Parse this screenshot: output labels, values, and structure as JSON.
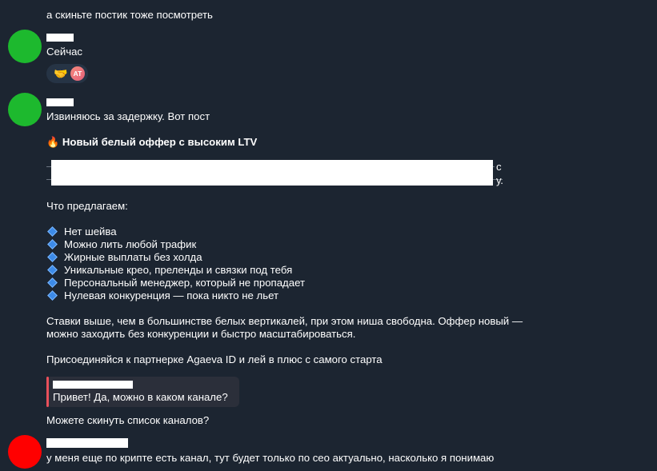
{
  "messages": {
    "top_text": "а скиньте постик тоже посмотреть",
    "m1": {
      "text": "Сейчас",
      "reaction_emoji": "🤝",
      "reaction_user_initials": "AT"
    },
    "m2": {
      "intro": "Извиняюсь за задержку. Вот пост",
      "fire": "🔥",
      "headline": "Новый белый оффер с высоким LTV",
      "partial_c": "с",
      "partial_y": "у.",
      "offer_heading": "Что предлагаем:",
      "bullets": [
        "Нет шейва",
        "Можно лить любой трафик",
        "Жирные выплаты без холда",
        "Уникальные крео, преленды и связки под тебя",
        "Персональный менеджер, который не пропадает",
        "Нулевая конкуренция — пока никто не льет"
      ],
      "para1_line1": "Ставки выше, чем в большинстве белых вертикалей, при этом ниша свободна. Оффер новый —",
      "para1_line2": "можно заходить без конкуренции и быстро масштабироваться.",
      "para2": "Присоединяйся к партнерке Agaeva ID и лей в плюс с самого старта"
    },
    "m3": {
      "reply_quote": "Привет! Да, можно в каком канале?",
      "text": "Можете скинуть список каналов?"
    },
    "m4": {
      "text": "у меня еще по крипте есть канал, тут будет только по сео актуально, насколько я понимаю"
    }
  },
  "colors": {
    "background": "#1c2531",
    "avatar_green": "#1db92e",
    "avatar_red": "#ff0000",
    "reply_accent": "#e8505b",
    "bullet_blue": "#3d8be8"
  },
  "icons": {
    "bullet": "blue-diamond-icon",
    "fire": "fire-icon",
    "reaction": "handshake-icon"
  }
}
